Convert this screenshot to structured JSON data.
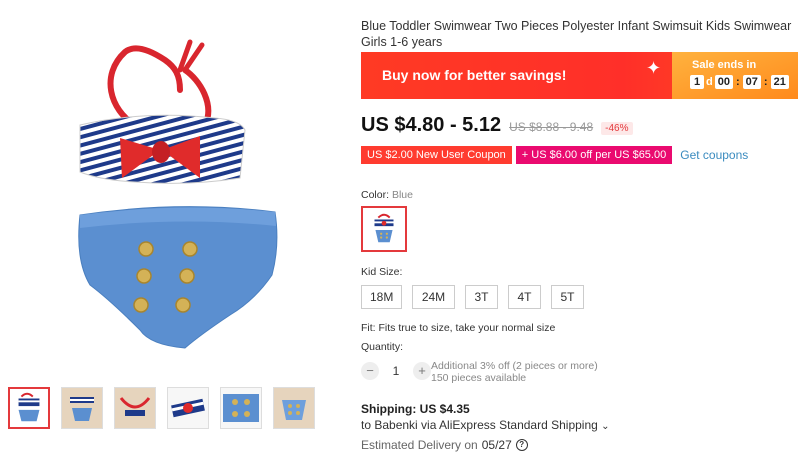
{
  "product": {
    "title": "Blue Toddler Swimwear Two Pieces Polyester Infant Swimsuit Kids Swimwear Girls 1-6 years",
    "main_image_alt": "swimsuit-image",
    "thumbnail_count": 6
  },
  "banner": {
    "text": "Buy now for better savings!",
    "sale_label": "Sale ends in",
    "countdown": {
      "days": "1",
      "days_unit": "d",
      "hours": "00",
      "minutes": "07",
      "seconds": "21"
    }
  },
  "price": {
    "current": "US $4.80 - 5.12",
    "original": "US $8.88 - 9.48",
    "discount": "-46%"
  },
  "coupons": {
    "new_user": "US $2.00 New User Coupon",
    "store": "+ US $6.00 off per US $65.00",
    "get_link": "Get coupons"
  },
  "color": {
    "label": "Color:",
    "selected": "Blue"
  },
  "size": {
    "label": "Kid Size:",
    "options": [
      "18M",
      "24M",
      "3T",
      "4T",
      "5T"
    ]
  },
  "fit": "Fit: Fits true to size, take your normal size",
  "quantity": {
    "label": "Quantity:",
    "value": "1",
    "minus": "−",
    "plus": "+",
    "offer": "Additional 3% off (2 pieces or more)",
    "available": "150 pieces available"
  },
  "shipping": {
    "title": "Shipping: US $4.35",
    "via": "to Babenki via AliExpress Standard Shipping",
    "chevron": "⌄",
    "delivery_prefix": "Estimated Delivery on",
    "delivery_date": "05/27",
    "help": "?"
  },
  "colors": {
    "accent_red": "#e4393c",
    "banner_red": "#ff3a24",
    "sale_orange": "#ff9a2a",
    "coupon_pink": "#ea0a6f",
    "link_blue": "#3a8bbf"
  },
  "icons": {
    "sparkle": "✦",
    "help": "question-circle-icon",
    "chevron": "chevron-down-icon"
  }
}
